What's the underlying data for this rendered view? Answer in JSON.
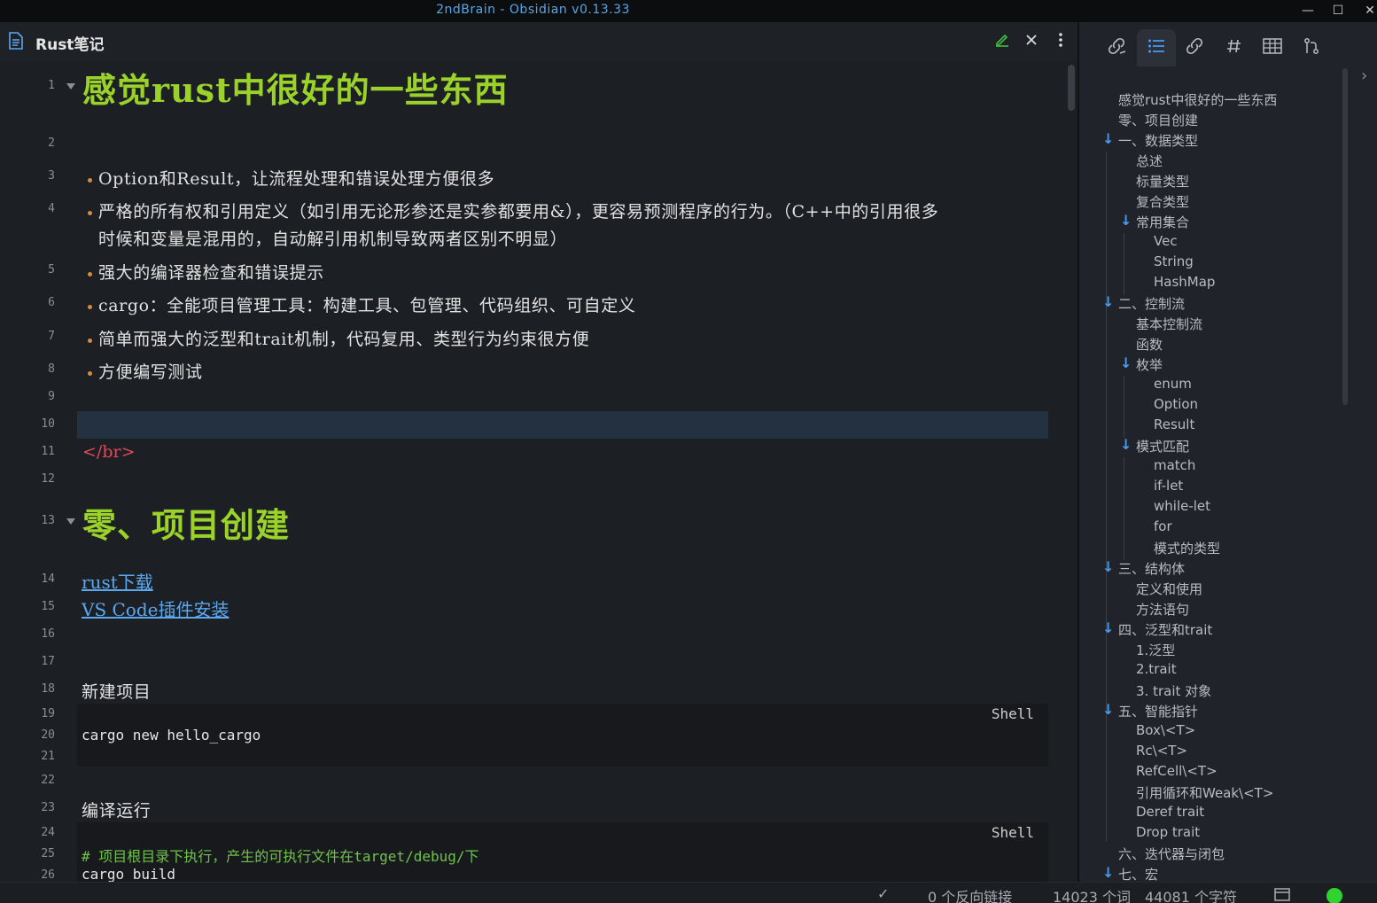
{
  "window": {
    "title": "2ndBrain - Obsidian v0.13.33",
    "controls": {
      "minimize": "—",
      "maximize": "☐",
      "close": "✕"
    }
  },
  "editor": {
    "tab_title": "Rust笔记",
    "line_numbers": [
      "1",
      "2",
      "3",
      "4",
      "5",
      "6",
      "7",
      "8",
      "9",
      "10",
      "11",
      "12",
      "13",
      "14",
      "15",
      "16",
      "17",
      "18",
      "19",
      "20",
      "21",
      "22",
      "23",
      "24",
      "25",
      "26"
    ],
    "heading1": "感觉rust中很好的一些东西",
    "bullets": [
      "Option和Result，让流程处理和错误处理方便很多",
      "严格的所有权和引用定义（如引用无论形参还是实参都要用&），更容易预测程序的行为。（C++中的引用很多",
      "强大的编译器检查和错误提示",
      "cargo：全能项目管理工具：构建工具、包管理、代码组织、可自定义",
      "简单而强大的泛型和trait机制，代码复用、类型行为约束很方便",
      "方便编写测试"
    ],
    "bullet2_wrap": "时候和变量是混用的，自动解引用机制导致两者区别不明显）",
    "html_tag": "</br>",
    "heading2": "零、项目创建",
    "links": [
      "rust下载",
      "VS Code插件安装"
    ],
    "new_project_label": "新建项目",
    "code_lang": "Shell",
    "code1": "cargo new hello_cargo",
    "compile_label": "编译运行",
    "code2_comment": "# 项目根目录下执行，产生的可执行文件在target/debug/下",
    "code2_line": "cargo build"
  },
  "outline": {
    "items": [
      {
        "label": "感觉rust中很好的一些东西",
        "level": 0,
        "arrow": false
      },
      {
        "label": "零、项目创建",
        "level": 0,
        "arrow": false
      },
      {
        "label": "一、数据类型",
        "level": 0,
        "arrow": true
      },
      {
        "label": "总述",
        "level": 1,
        "arrow": false
      },
      {
        "label": "标量类型",
        "level": 1,
        "arrow": false
      },
      {
        "label": "复合类型",
        "level": 1,
        "arrow": false
      },
      {
        "label": "常用集合",
        "level": 1,
        "arrow": true
      },
      {
        "label": "Vec",
        "level": 2,
        "arrow": false
      },
      {
        "label": "String",
        "level": 2,
        "arrow": false
      },
      {
        "label": "HashMap",
        "level": 2,
        "arrow": false
      },
      {
        "label": "二、控制流",
        "level": 0,
        "arrow": true
      },
      {
        "label": "基本控制流",
        "level": 1,
        "arrow": false
      },
      {
        "label": "函数",
        "level": 1,
        "arrow": false
      },
      {
        "label": "枚举",
        "level": 1,
        "arrow": true
      },
      {
        "label": "enum",
        "level": 2,
        "arrow": false
      },
      {
        "label": "Option",
        "level": 2,
        "arrow": false
      },
      {
        "label": "Result",
        "level": 2,
        "arrow": false
      },
      {
        "label": "模式匹配",
        "level": 1,
        "arrow": true
      },
      {
        "label": "match",
        "level": 2,
        "arrow": false
      },
      {
        "label": "if-let",
        "level": 2,
        "arrow": false
      },
      {
        "label": "while-let",
        "level": 2,
        "arrow": false
      },
      {
        "label": "for",
        "level": 2,
        "arrow": false
      },
      {
        "label": "模式的类型",
        "level": 2,
        "arrow": false
      },
      {
        "label": "三、结构体",
        "level": 0,
        "arrow": true
      },
      {
        "label": "定义和使用",
        "level": 1,
        "arrow": false
      },
      {
        "label": "方法语句",
        "level": 1,
        "arrow": false
      },
      {
        "label": "四、泛型和trait",
        "level": 0,
        "arrow": true
      },
      {
        "label": "1.泛型",
        "level": 1,
        "arrow": false
      },
      {
        "label": "2.trait",
        "level": 1,
        "arrow": false
      },
      {
        "label": "3. trait 对象",
        "level": 1,
        "arrow": false
      },
      {
        "label": "五、智能指针",
        "level": 0,
        "arrow": true
      },
      {
        "label": "Box\\<T>",
        "level": 1,
        "arrow": false
      },
      {
        "label": "Rc\\<T>",
        "level": 1,
        "arrow": false
      },
      {
        "label": "RefCell\\<T>",
        "level": 1,
        "arrow": false
      },
      {
        "label": "引用循环和Weak\\<T>",
        "level": 1,
        "arrow": false
      },
      {
        "label": "Deref trait",
        "level": 1,
        "arrow": false
      },
      {
        "label": "Drop trait",
        "level": 1,
        "arrow": false
      },
      {
        "label": "六、迭代器与闭包",
        "level": 0,
        "arrow": false
      },
      {
        "label": "七、宏",
        "level": 0,
        "arrow": true
      }
    ]
  },
  "status": {
    "backlinks": "0 个反向链接",
    "words": "14023 个词",
    "chars": "44081 个字符"
  },
  "colors": {
    "heading": "#9bd22a",
    "accent": "#4a9cf0",
    "bullet": "#d98a3a",
    "link": "#5aa8f0",
    "html_tag": "#e04a5a",
    "comment": "#6fc24a",
    "status_dot": "#2fd42f"
  }
}
